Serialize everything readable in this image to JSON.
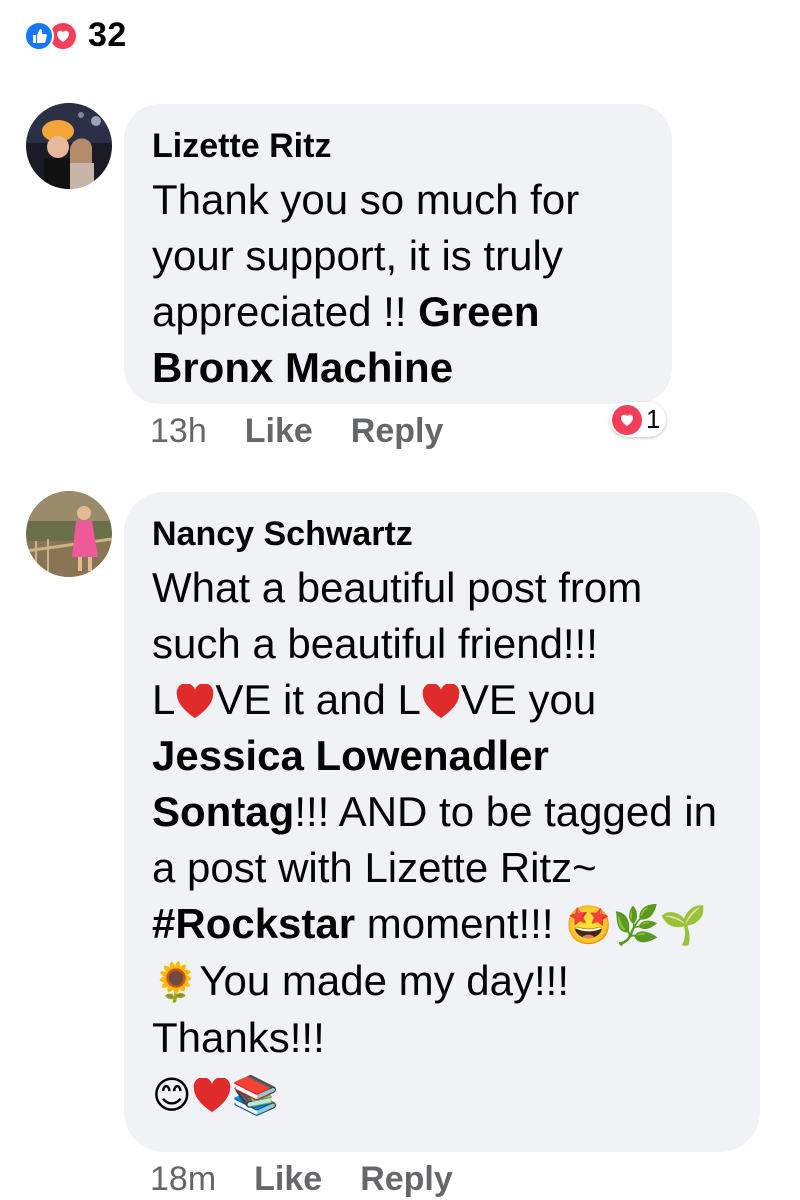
{
  "post": {
    "reaction_count": "32",
    "reaction_types": [
      "like-icon",
      "love-icon"
    ]
  },
  "comments": [
    {
      "author": "Lizette Ritz",
      "text_plain": "Thank you so much for your support, it is truly appreciated !! ",
      "tag": "Green Bronx Machine",
      "time": "13h",
      "like_label": "Like",
      "reply_label": "Reply",
      "reaction_count": "1"
    },
    {
      "author": "Nancy Schwartz",
      "line1": "What a beautiful post from such a beautiful friend!!!",
      "love_a_pre": "L",
      "love_a_post": "VE it and L",
      "love_b_post": "VE you",
      "tag": "Jessica Lowenadler Sontag",
      "after_tag": "!!! AND to be tagged in a post with Lizette Ritz~ ",
      "hashtag": "#Rockstar",
      "moment": " moment!!! ",
      "you_made": "You made my day!!! Thanks!!!",
      "time": "18m",
      "like_label": "Like",
      "reply_label": "Reply"
    }
  ],
  "colors": {
    "like_blue": "#1877f2",
    "love_red": "#f33e58",
    "bubble_bg": "#f0f2f5",
    "meta_gray": "#65676b"
  }
}
